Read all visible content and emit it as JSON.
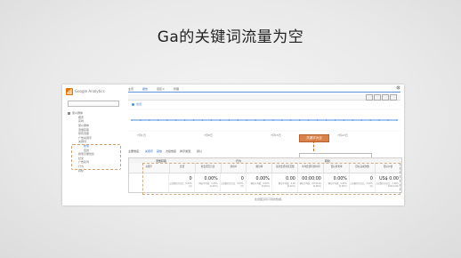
{
  "slide": {
    "title": "Ga的关键词流量为空"
  },
  "app": {
    "logo_text": "Google Analytics"
  },
  "sidebar": {
    "account_value": "",
    "items": [
      {
        "label": "受众群体",
        "level": 0
      },
      {
        "label": "概览",
        "level": 1
      },
      {
        "label": "实时",
        "level": 1
      },
      {
        "label": "受众群体",
        "level": 1
      },
      {
        "label": "流量获取",
        "level": 1
      },
      {
        "label": "所有流量",
        "level": 1
      },
      {
        "label": "广告关键字",
        "level": 1
      },
      {
        "label": "关键词",
        "level": 1
      },
      {
        "label": "搜索",
        "level": 2
      },
      {
        "label": "自然",
        "level": 2
      },
      {
        "label": "搜索引擎优化",
        "level": 1
      },
      {
        "label": "社交",
        "level": 1
      },
      {
        "label": "广告系列",
        "level": 1
      },
      {
        "label": "行为",
        "level": 1
      },
      {
        "label": "转化",
        "level": 1
      }
    ]
  },
  "topnav": [
    "主页",
    "报告",
    "自定义",
    "管理"
  ],
  "chart": {
    "legend": "会话",
    "x_labels": [
      "7月1日",
      "7月8日",
      "7月15日",
      "7月22日"
    ]
  },
  "tooltip": "关键字为空",
  "controls": {
    "primary_dim_label": "主要维度：",
    "primary_dim_value": "关键字",
    "other": "其他",
    "secondary_dim": "次级维度",
    "sort": "排序类型：",
    "sort_value": "默认"
  },
  "table": {
    "group_headers": [
      "流量获取",
      "行为",
      "转化"
    ],
    "headers": [
      "关键字",
      "会话",
      "新会话百分比",
      "新用户",
      "跳出率",
      "每次会话浏览页数",
      "平均会话持续时间",
      "目标转化率",
      "目标完成次数",
      "目标价值"
    ],
    "totals": [
      "",
      "0",
      "0.00%",
      "0",
      "0.00%",
      "0.00",
      "00:00:00",
      "0.00%",
      "0",
      "US$ 0.00"
    ],
    "totals_sub": [
      "",
      "占总数的百分比：0.00% (0)",
      "网站平均值：0.00% (0.00%)",
      "占总数的百分比：0.00% (0)",
      "网站平均值：0.00% (0.00%)",
      "网站平均值：0.00 (0.00%)",
      "网站平均值：00:00:00 (0.00%)",
      "网站平均值：0.00% (0.00%)",
      "占总数的百分比：0.00% (0)",
      "占总数的百分比：0.00% (US$ 0.00)"
    ]
  },
  "footer_note": "此视图没有可用的数据。",
  "colors": {
    "accent_blue": "#2a6bbf",
    "tooltip_orange": "#d9824a",
    "line_blue": "#4a90e2"
  }
}
